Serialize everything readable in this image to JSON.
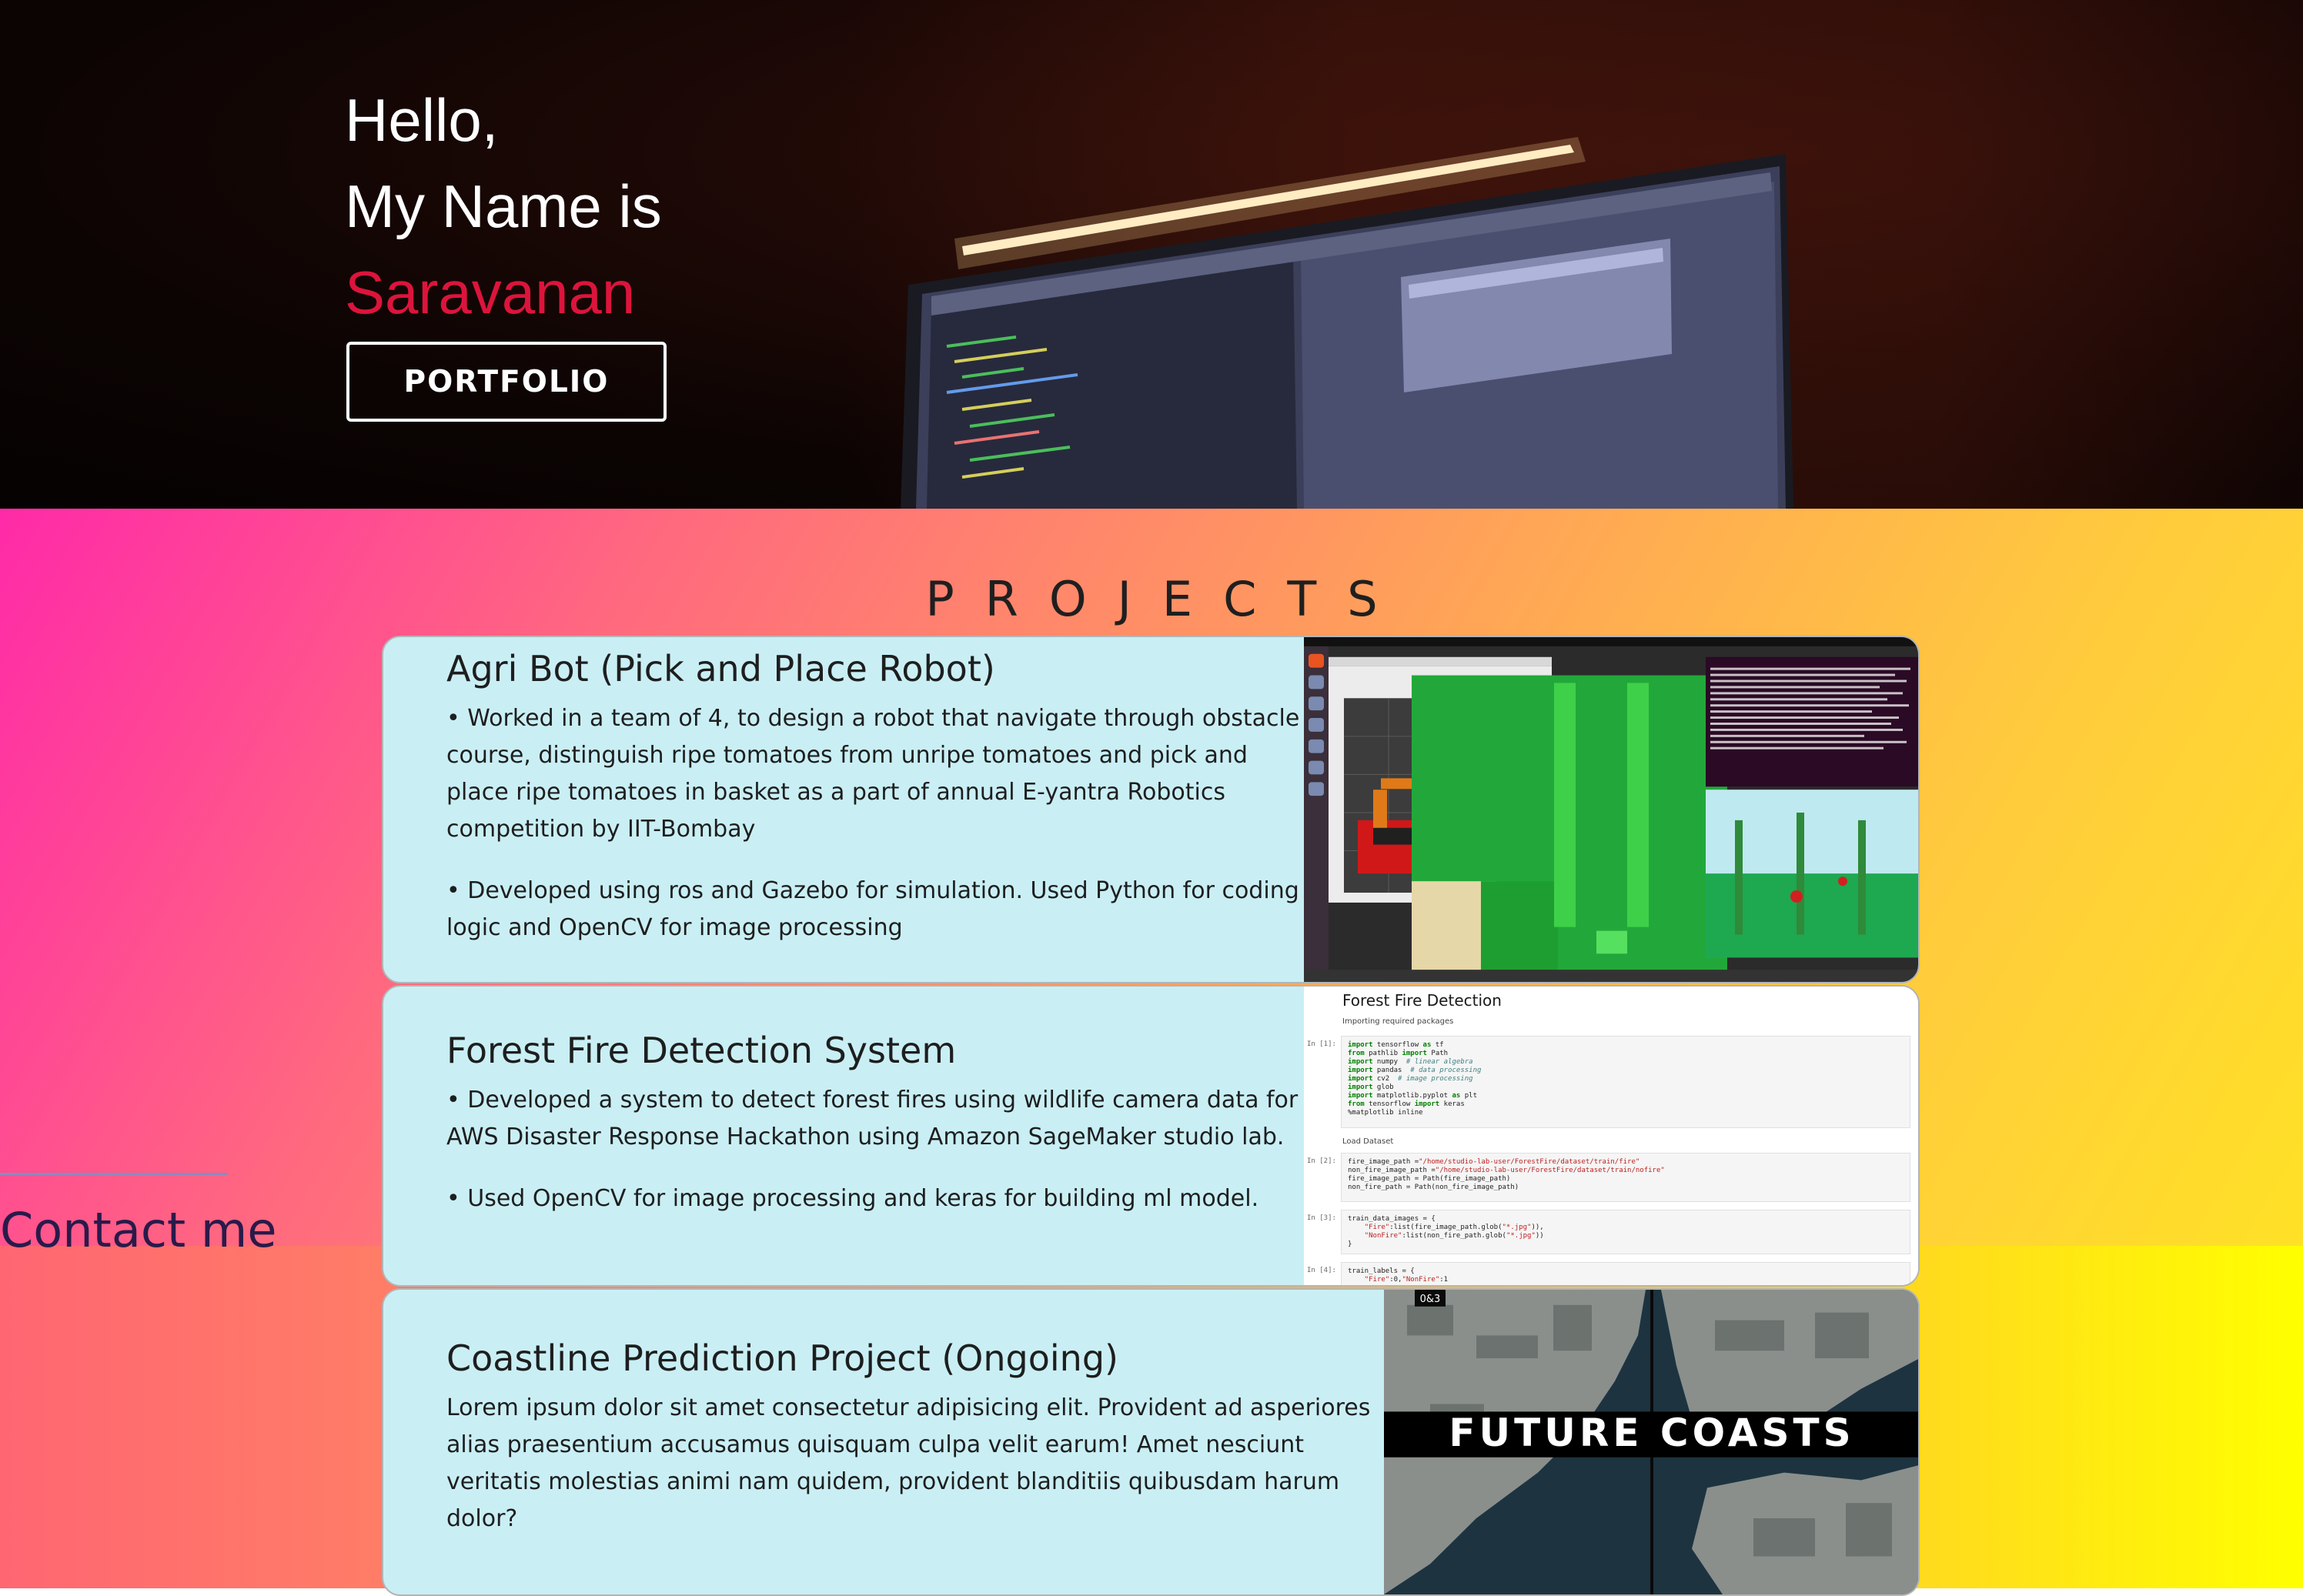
{
  "hero": {
    "greeting": "Hello,",
    "intro": "My Name is",
    "name": "Saravanan",
    "portfolio_button": "PORTFOLIO",
    "name_color": "#dc143c"
  },
  "projects": {
    "heading": "PROJECTS",
    "items": [
      {
        "title": "Agri Bot (Pick and Place Robot)",
        "points": [
          "• Worked in a team of 4, to design a robot that navigate through obstacle course, distinguish ripe tomatoes from unripe tomatoes and pick and place ripe tomatoes in basket as a part of annual E-yantra Robotics competition by IIT-Bombay",
          "• Developed using ros and Gazebo for simulation. Used Python for coding logic and OpenCV for image processing"
        ],
        "image": "ros-gazebo-simulation-screenshot"
      },
      {
        "title": "Forest Fire Detection System",
        "points": [
          "• Developed a system to detect forest fires using wildlife camera data for AWS Disaster Response Hackathon using Amazon SageMaker studio lab.",
          "• Used OpenCV for image processing and keras for building ml model."
        ],
        "image": "jupyter-notebook-screenshot",
        "notebook": {
          "title": "Forest Fire Detection",
          "section_1": "Importing required packages",
          "section_2": "Load Dataset",
          "prompt_1": "In [1]:",
          "prompt_2": "In [2]:",
          "prompt_3": "In [3]:",
          "prompt_4": "In [4]:"
        }
      },
      {
        "title": "Coastline Prediction Project (Ongoing)",
        "points": [
          "Lorem ipsum dolor sit amet consectetur adipisicing elit. Provident ad asperiores alias praesentium accusamus quisquam culpa velit earum! Amet nesciunt veritatis molestias animi nam quidem, provident blanditiis quibusdam harum dolor?"
        ],
        "image": "satellite-coastline-image",
        "image_caption": "FUTURE COASTS",
        "image_badge": "0&3"
      }
    ]
  },
  "contact": {
    "heading": "Contact me"
  }
}
